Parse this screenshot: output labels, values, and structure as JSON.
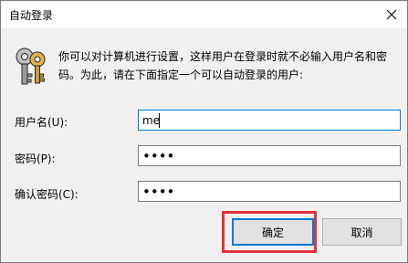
{
  "window": {
    "title": "自动登录"
  },
  "message": {
    "line1": "你可以对计算机进行设置，这样用户在登录时就不必输入用户名和密",
    "line2": "码。为此，请在下面指定一个可以自动登录的用户:"
  },
  "fields": {
    "username": {
      "label": "用户名(U):",
      "value": "me"
    },
    "password": {
      "label": "密码(P):",
      "value": "••••"
    },
    "confirm_password": {
      "label": "确认密码(C):",
      "value": "••••"
    }
  },
  "buttons": {
    "ok": "确定",
    "cancel": "取消"
  },
  "icons": {
    "title_close": "close-icon",
    "message": "keys-icon"
  },
  "colors": {
    "highlight": "#e0323b",
    "focus": "#0078d7"
  }
}
